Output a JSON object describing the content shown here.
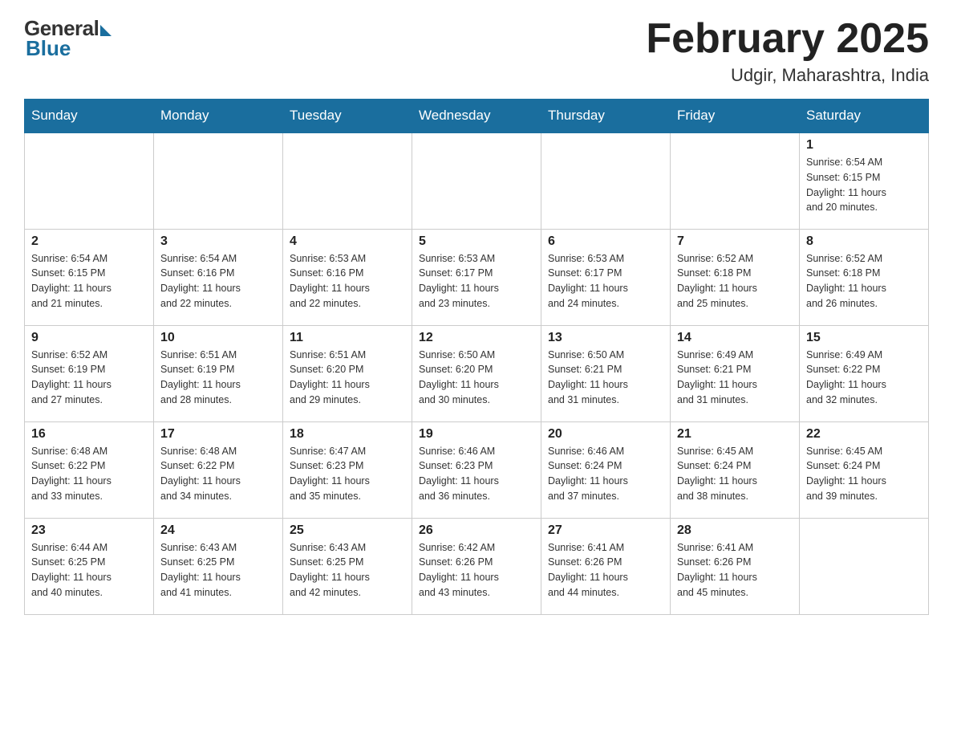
{
  "header": {
    "logo_general": "General",
    "logo_blue": "Blue",
    "month_title": "February 2025",
    "location": "Udgir, Maharashtra, India"
  },
  "weekdays": [
    "Sunday",
    "Monday",
    "Tuesday",
    "Wednesday",
    "Thursday",
    "Friday",
    "Saturday"
  ],
  "weeks": [
    [
      {
        "day": "",
        "info": ""
      },
      {
        "day": "",
        "info": ""
      },
      {
        "day": "",
        "info": ""
      },
      {
        "day": "",
        "info": ""
      },
      {
        "day": "",
        "info": ""
      },
      {
        "day": "",
        "info": ""
      },
      {
        "day": "1",
        "info": "Sunrise: 6:54 AM\nSunset: 6:15 PM\nDaylight: 11 hours\nand 20 minutes."
      }
    ],
    [
      {
        "day": "2",
        "info": "Sunrise: 6:54 AM\nSunset: 6:15 PM\nDaylight: 11 hours\nand 21 minutes."
      },
      {
        "day": "3",
        "info": "Sunrise: 6:54 AM\nSunset: 6:16 PM\nDaylight: 11 hours\nand 22 minutes."
      },
      {
        "day": "4",
        "info": "Sunrise: 6:53 AM\nSunset: 6:16 PM\nDaylight: 11 hours\nand 22 minutes."
      },
      {
        "day": "5",
        "info": "Sunrise: 6:53 AM\nSunset: 6:17 PM\nDaylight: 11 hours\nand 23 minutes."
      },
      {
        "day": "6",
        "info": "Sunrise: 6:53 AM\nSunset: 6:17 PM\nDaylight: 11 hours\nand 24 minutes."
      },
      {
        "day": "7",
        "info": "Sunrise: 6:52 AM\nSunset: 6:18 PM\nDaylight: 11 hours\nand 25 minutes."
      },
      {
        "day": "8",
        "info": "Sunrise: 6:52 AM\nSunset: 6:18 PM\nDaylight: 11 hours\nand 26 minutes."
      }
    ],
    [
      {
        "day": "9",
        "info": "Sunrise: 6:52 AM\nSunset: 6:19 PM\nDaylight: 11 hours\nand 27 minutes."
      },
      {
        "day": "10",
        "info": "Sunrise: 6:51 AM\nSunset: 6:19 PM\nDaylight: 11 hours\nand 28 minutes."
      },
      {
        "day": "11",
        "info": "Sunrise: 6:51 AM\nSunset: 6:20 PM\nDaylight: 11 hours\nand 29 minutes."
      },
      {
        "day": "12",
        "info": "Sunrise: 6:50 AM\nSunset: 6:20 PM\nDaylight: 11 hours\nand 30 minutes."
      },
      {
        "day": "13",
        "info": "Sunrise: 6:50 AM\nSunset: 6:21 PM\nDaylight: 11 hours\nand 31 minutes."
      },
      {
        "day": "14",
        "info": "Sunrise: 6:49 AM\nSunset: 6:21 PM\nDaylight: 11 hours\nand 31 minutes."
      },
      {
        "day": "15",
        "info": "Sunrise: 6:49 AM\nSunset: 6:22 PM\nDaylight: 11 hours\nand 32 minutes."
      }
    ],
    [
      {
        "day": "16",
        "info": "Sunrise: 6:48 AM\nSunset: 6:22 PM\nDaylight: 11 hours\nand 33 minutes."
      },
      {
        "day": "17",
        "info": "Sunrise: 6:48 AM\nSunset: 6:22 PM\nDaylight: 11 hours\nand 34 minutes."
      },
      {
        "day": "18",
        "info": "Sunrise: 6:47 AM\nSunset: 6:23 PM\nDaylight: 11 hours\nand 35 minutes."
      },
      {
        "day": "19",
        "info": "Sunrise: 6:46 AM\nSunset: 6:23 PM\nDaylight: 11 hours\nand 36 minutes."
      },
      {
        "day": "20",
        "info": "Sunrise: 6:46 AM\nSunset: 6:24 PM\nDaylight: 11 hours\nand 37 minutes."
      },
      {
        "day": "21",
        "info": "Sunrise: 6:45 AM\nSunset: 6:24 PM\nDaylight: 11 hours\nand 38 minutes."
      },
      {
        "day": "22",
        "info": "Sunrise: 6:45 AM\nSunset: 6:24 PM\nDaylight: 11 hours\nand 39 minutes."
      }
    ],
    [
      {
        "day": "23",
        "info": "Sunrise: 6:44 AM\nSunset: 6:25 PM\nDaylight: 11 hours\nand 40 minutes."
      },
      {
        "day": "24",
        "info": "Sunrise: 6:43 AM\nSunset: 6:25 PM\nDaylight: 11 hours\nand 41 minutes."
      },
      {
        "day": "25",
        "info": "Sunrise: 6:43 AM\nSunset: 6:25 PM\nDaylight: 11 hours\nand 42 minutes."
      },
      {
        "day": "26",
        "info": "Sunrise: 6:42 AM\nSunset: 6:26 PM\nDaylight: 11 hours\nand 43 minutes."
      },
      {
        "day": "27",
        "info": "Sunrise: 6:41 AM\nSunset: 6:26 PM\nDaylight: 11 hours\nand 44 minutes."
      },
      {
        "day": "28",
        "info": "Sunrise: 6:41 AM\nSunset: 6:26 PM\nDaylight: 11 hours\nand 45 minutes."
      },
      {
        "day": "",
        "info": ""
      }
    ]
  ]
}
